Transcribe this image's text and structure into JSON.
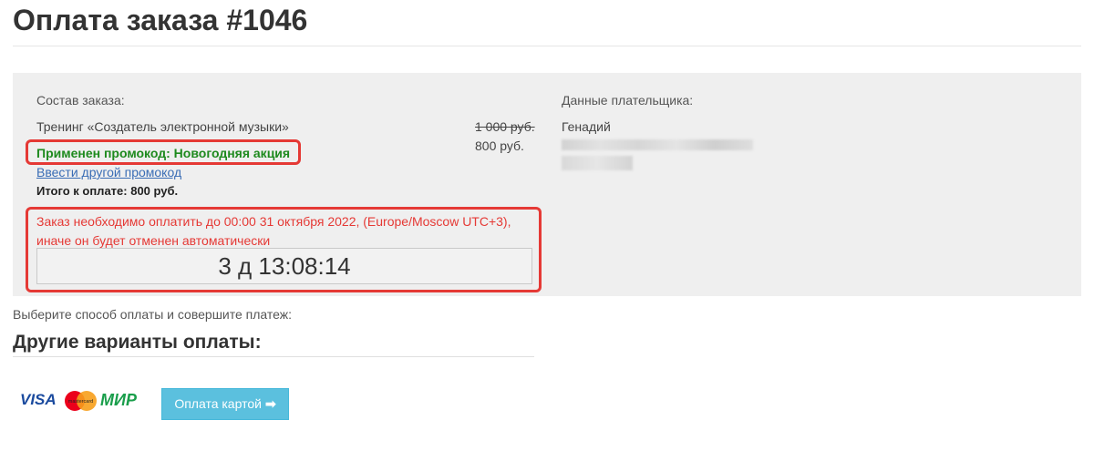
{
  "page": {
    "title": "Оплата заказа #1046"
  },
  "order": {
    "heading": "Состав заказа:",
    "item_name": "Тренинг «Создатель электронной музыки»",
    "old_price": "1 000 руб.",
    "new_price": "800 руб.",
    "promo_applied": "Применен промокод: Новогодняя акция",
    "promo_link": "Ввести другой промокод",
    "total": "Итого к оплате: 800 руб.",
    "deadline_text": "Заказ необходимо оплатить до 00:00 31 октября 2022, (Europe/Moscow UTC+3), иначе он будет отменен автоматически",
    "countdown": "3 д 13:08:14"
  },
  "payer": {
    "heading": "Данные плательщика:",
    "name": "Генадий"
  },
  "payment": {
    "choose_text": "Выберите способ оплаты и совершите платеж:",
    "other_heading": "Другие варианты оплаты:",
    "logos": {
      "visa": "VISA",
      "mastercard": "mastercard",
      "mir": "МИР"
    },
    "card_button": "Оплата картой",
    "card_button_icon": "arrow-right-icon"
  },
  "colors": {
    "highlight_red": "#e53935",
    "promo_green": "#1e8a1e",
    "link_blue": "#3a6db5",
    "button_blue": "#5bc0de",
    "panel_gray": "#efefef"
  }
}
